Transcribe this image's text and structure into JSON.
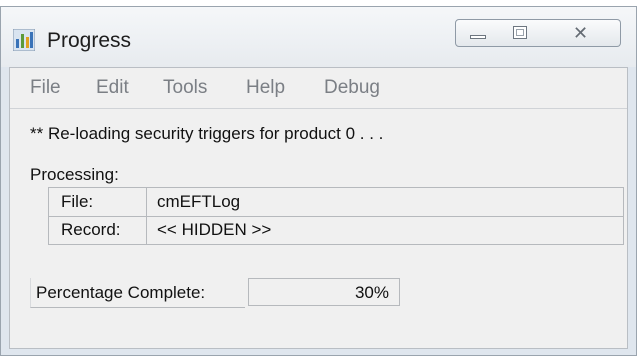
{
  "window": {
    "title": "Progress",
    "icon": "app-chart-icon",
    "buttons": {
      "minimize": "minimize-icon",
      "maximize": "maximize-icon",
      "close": "close-icon"
    }
  },
  "menu": [
    "File",
    "Edit",
    "Tools",
    "Help",
    "Debug"
  ],
  "status_message": "** Re-loading security triggers for product 0 . . .",
  "processing": {
    "label": "Processing:",
    "rows": [
      {
        "key": "File:",
        "value": "cmEFTLog"
      },
      {
        "key": "Record:",
        "value": "<< HIDDEN >>"
      }
    ]
  },
  "progress": {
    "label": "Percentage Complete:",
    "value_text": "30%",
    "fraction": 0.3
  }
}
